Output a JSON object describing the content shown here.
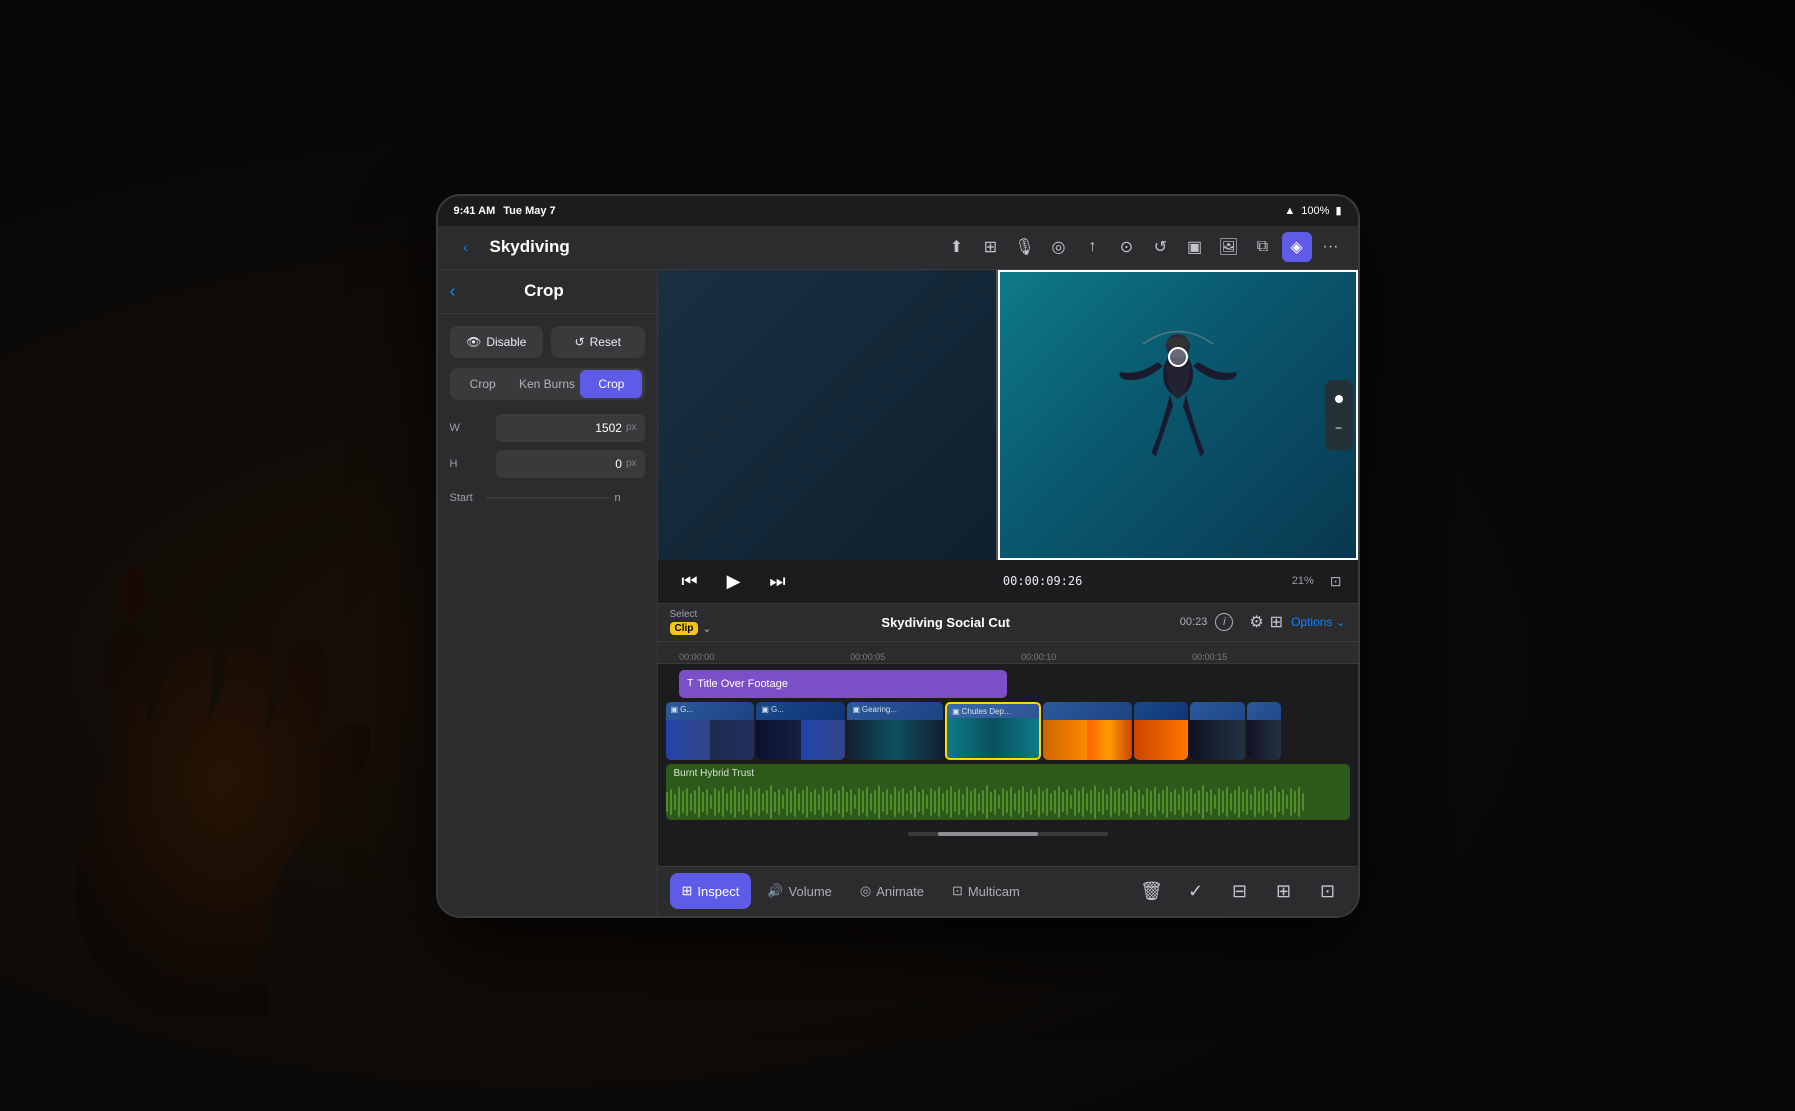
{
  "scene": {
    "bg_color": "#080808"
  },
  "status_bar": {
    "time": "9:41 AM",
    "date": "Tue May 7",
    "battery": "100%",
    "wifi": "WiFi"
  },
  "nav": {
    "back_label": "‹",
    "title": "Skydiving",
    "icons": [
      "square.and.arrow.up",
      "photo.on.rectangle",
      "mic",
      "location",
      "square.and.arrow.up.on.square"
    ]
  },
  "crop_panel": {
    "back_label": "‹",
    "title": "Crop",
    "disable_label": "Disable",
    "reset_label": "Reset",
    "tabs": [
      "Crop",
      "Ken Burns",
      "Crop"
    ],
    "active_tab": 2,
    "width_value": "1502",
    "width_unit": "px",
    "height_value": "0",
    "height_unit": "px",
    "start_label": "Start",
    "end_label": "n"
  },
  "video_preview": {
    "timecode": "00:00:09:26",
    "zoom_percent": "21",
    "zoom_unit": "%"
  },
  "project_bar": {
    "select_label": "Select",
    "clip_label": "Clip",
    "project_name": "Skydiving Social Cut",
    "duration": "00:23",
    "options_label": "Options"
  },
  "timeline": {
    "ruler_marks": [
      "00:00:00",
      "00:00:05",
      "00:00:10",
      "00:00:15"
    ],
    "title_clip": "Title Over Footage",
    "clips": [
      {
        "label": "G...",
        "width": 13,
        "color": "c1"
      },
      {
        "label": "G...",
        "width": 13,
        "color": "c2"
      },
      {
        "label": "Gearing...",
        "width": 14,
        "color": "c1"
      },
      {
        "label": "Chutes Dep...",
        "width": 14,
        "color": "selected"
      },
      {
        "label": "",
        "width": 13,
        "color": "c1"
      },
      {
        "label": "",
        "width": 8,
        "color": "c2"
      },
      {
        "label": "",
        "width": 8,
        "color": "c3"
      },
      {
        "label": "",
        "width": 5,
        "color": "c1"
      }
    ],
    "audio_label": "Burnt Hybrid Trust"
  },
  "bottom_tabs": {
    "inspect": "Inspect",
    "volume": "Volume",
    "animate": "Animate",
    "multicam": "Multicam"
  }
}
